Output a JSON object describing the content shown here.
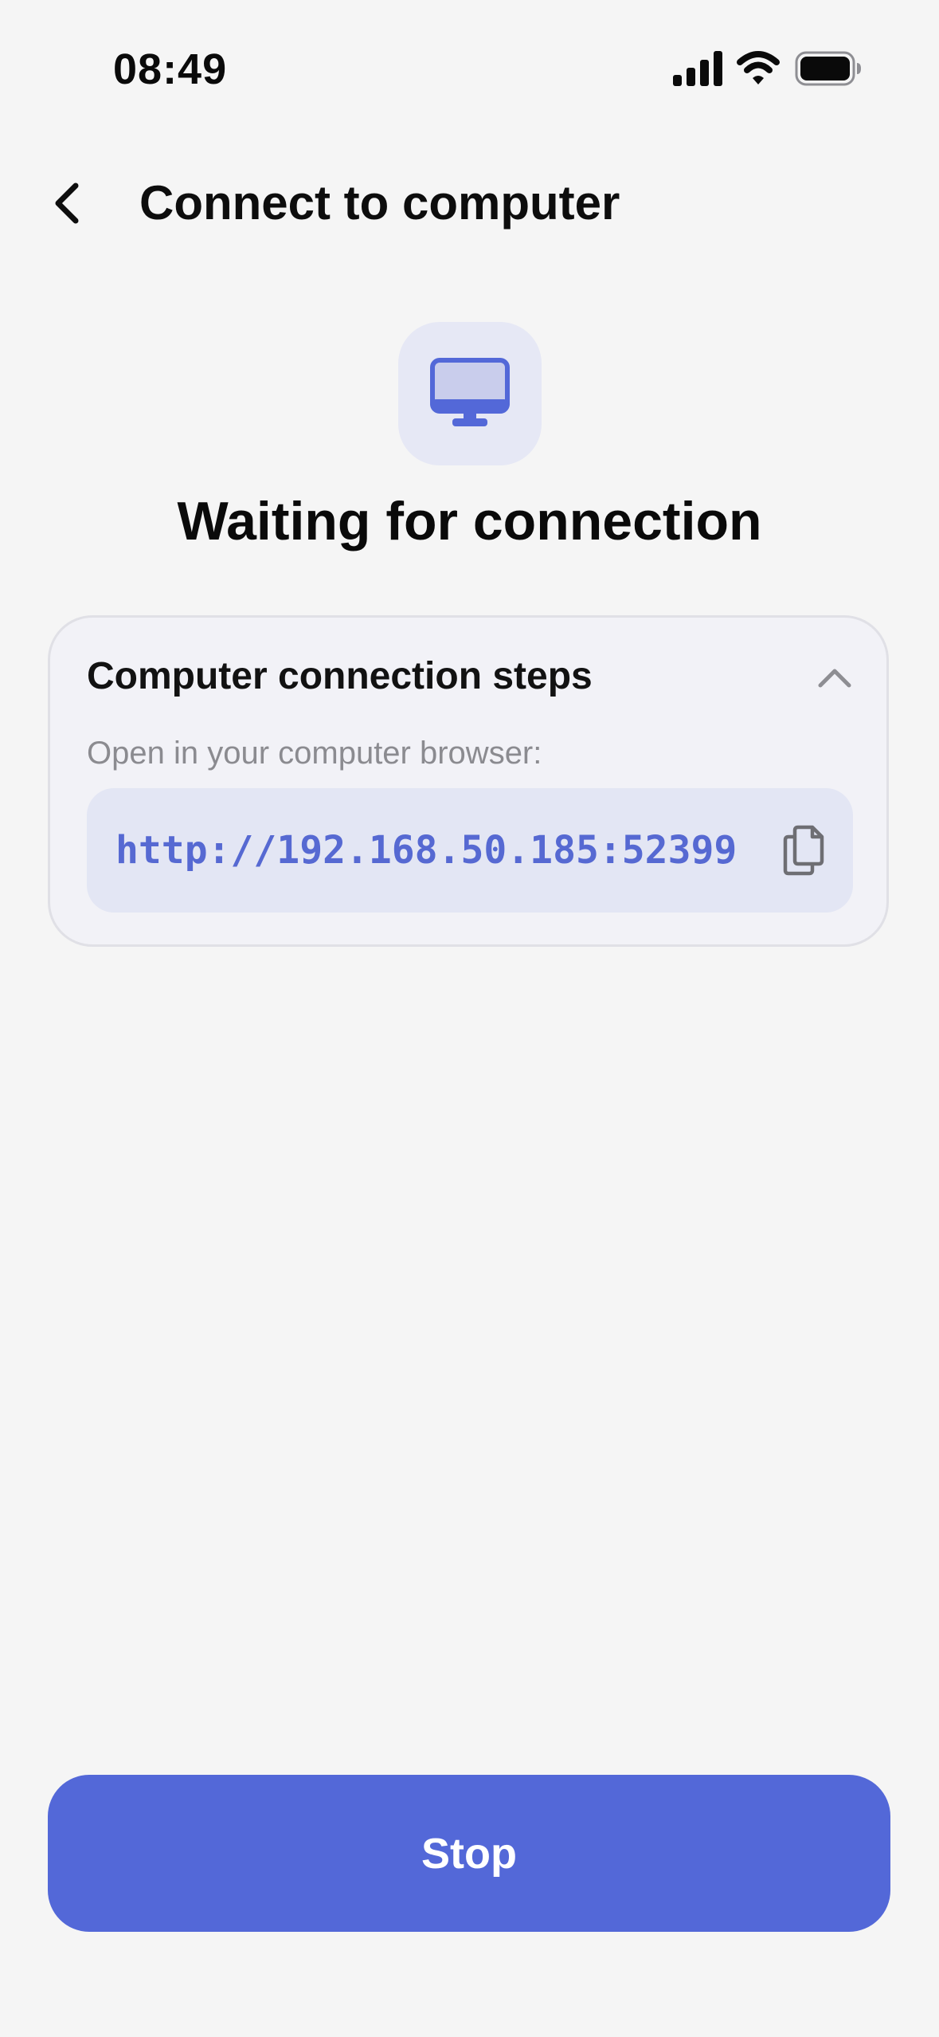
{
  "status_bar": {
    "time": "08:49",
    "icons": [
      "cellular-signal-icon",
      "wifi-icon",
      "battery-icon"
    ]
  },
  "nav": {
    "back_icon": "chevron-left-icon",
    "title": "Connect to computer"
  },
  "status": {
    "icon": "desktop-computer-icon",
    "title": "Waiting for connection"
  },
  "steps_card": {
    "title": "Computer connection steps",
    "toggle_icon": "chevron-up-icon",
    "hint": "Open in your computer browser:",
    "url": "http://192.168.50.185:52399",
    "copy_icon": "copy-icon"
  },
  "actions": {
    "stop_label": "Stop"
  },
  "colors": {
    "accent": "#5368d8",
    "url_text": "#5669d2",
    "url_background": "#e3e6f4",
    "background": "#f5f5f5"
  }
}
